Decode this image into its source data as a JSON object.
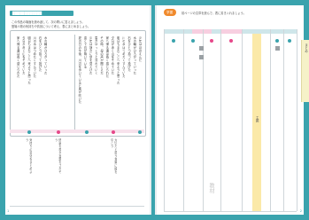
{
  "left_page": {
    "title_bar": "████████████",
    "intro_lines": [
      "この作品の場面を読み返して、次の問いに答えましょう。",
      "登場人物の気持ちや情景について考え、表にまとめましょう。"
    ],
    "poem_text": [
      "夏の日の午後、川辺を歩いていると風が吹いた",
      "遠くで鳥が鳴いている",
      "少年は静かに空を見上げた",
      "雲がゆっくりと流れていく",
      "その時、母の声が聞こえた",
      "家へ帰る道は長く感じられた",
      "夕日が赤く山をそめていた",
      "明日もまたここへ来ようと思った",
      "川の水はつめたくすんでいた",
      "石をひとつ拾って投げた",
      "水の輪がひろがっていった",
      "少年はほほえんだ"
    ],
    "notes": [
      "気持ちの変化をまとめよう",
      "情景を表す言葉をさがそう",
      "大切だと思う言葉に線を引こう"
    ],
    "page_no": "1"
  },
  "right_page": {
    "badge": "学習",
    "instruction": "前ページの文章を読んで、表に書き入れましょう。",
    "col_headers": [
      "",
      "",
      "",
      "",
      ""
    ],
    "center_label": "主題",
    "handwriting": "教材",
    "side_label": "まとめ",
    "page_no": "2"
  },
  "colors": {
    "accent": "#3aa3ad",
    "pink": "#e6488a",
    "yellow": "#fbe9a8"
  }
}
